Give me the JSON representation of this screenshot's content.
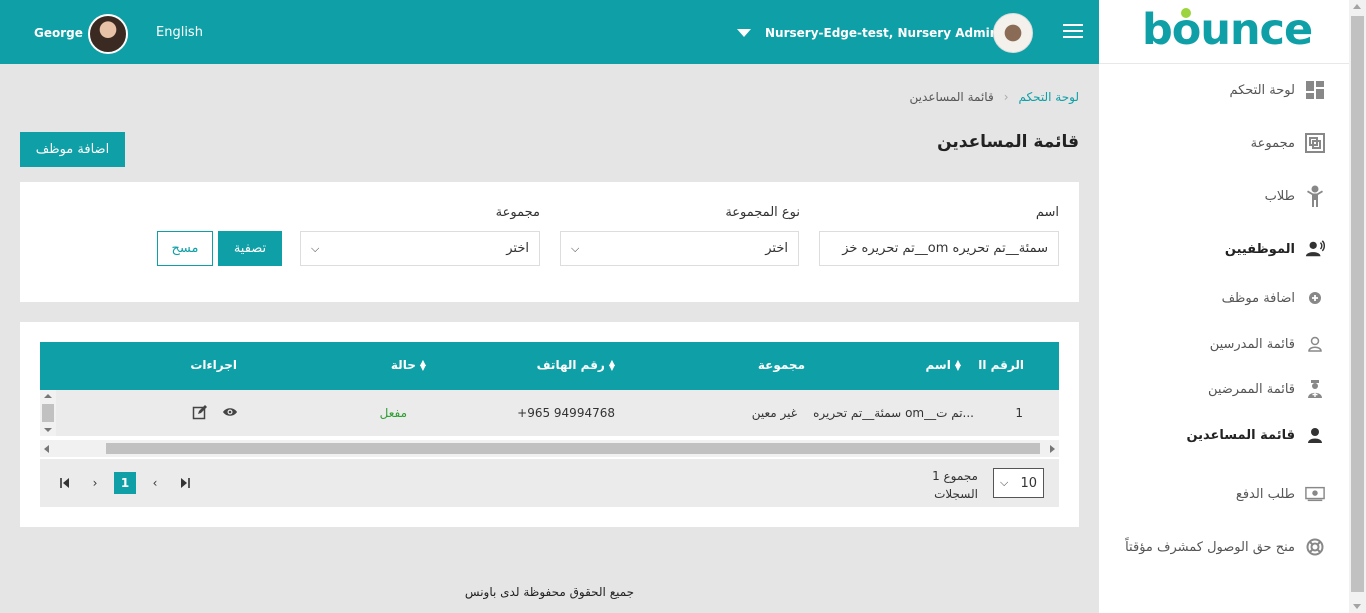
{
  "topbar": {
    "user_name": "George",
    "language": "English",
    "org_label": "Nursery-Edge-test, Nursery Admin"
  },
  "brand": {
    "name": "bounce",
    "color": "#0fa0a7",
    "accent": "#9bd43e"
  },
  "sidebar": {
    "items": [
      {
        "label": "لوحة التحكم",
        "icon": "dashboard-icon"
      },
      {
        "label": "مجموعة",
        "icon": "group-icon"
      },
      {
        "label": "طلاب",
        "icon": "student-icon"
      },
      {
        "label": "الموظفيين",
        "icon": "staff-icon"
      },
      {
        "label": "اضافة موظف",
        "icon": "add-circle-icon"
      },
      {
        "label": "قائمة المدرسين",
        "icon": "teacher-icon"
      },
      {
        "label": "قائمة الممرضين",
        "icon": "nurse-icon"
      },
      {
        "label": "قائمة المساعدين",
        "icon": "assistant-icon"
      },
      {
        "label": "طلب الدفع",
        "icon": "payment-icon"
      },
      {
        "label": "منح حق الوصول كمشرف مؤقتاً",
        "icon": "lifebuoy-icon"
      }
    ]
  },
  "breadcrumb": {
    "home": "لوحة التحكم",
    "current": "قائمة المساعدين"
  },
  "page": {
    "title": "قائمة المساعدين",
    "add_button": "اضافة موظف"
  },
  "filters": {
    "name_label": "اسم",
    "name_value": "سمئة__تم تحريره om__تم تحريره خز",
    "group_type_label": "نوع المجموعة",
    "group_type_value": "اختر",
    "group_label": "مجموعة",
    "group_value": "اختر",
    "filter_button": "تصفية",
    "clear_button": "مسح"
  },
  "table": {
    "headers": {
      "number": "الرقم اا",
      "name": "اسم",
      "group": "مجموعة",
      "phone": "رقم الهاتف",
      "status": "حالة",
      "actions": "اجراءات"
    },
    "rows": [
      {
        "number": "1",
        "name": "سمئة__تم تحريره om__تم ت...",
        "group": "غير معين",
        "phone": "+965 94994768",
        "status": "مفعل"
      }
    ],
    "status_color": "#2e9e32"
  },
  "pagination": {
    "per_page": "10",
    "total_line1": "1 مجموع",
    "total_line2": "السجلات",
    "current_page": "1"
  },
  "footer": {
    "text": "جميع الحقوق محفوظة لدى باونس"
  }
}
